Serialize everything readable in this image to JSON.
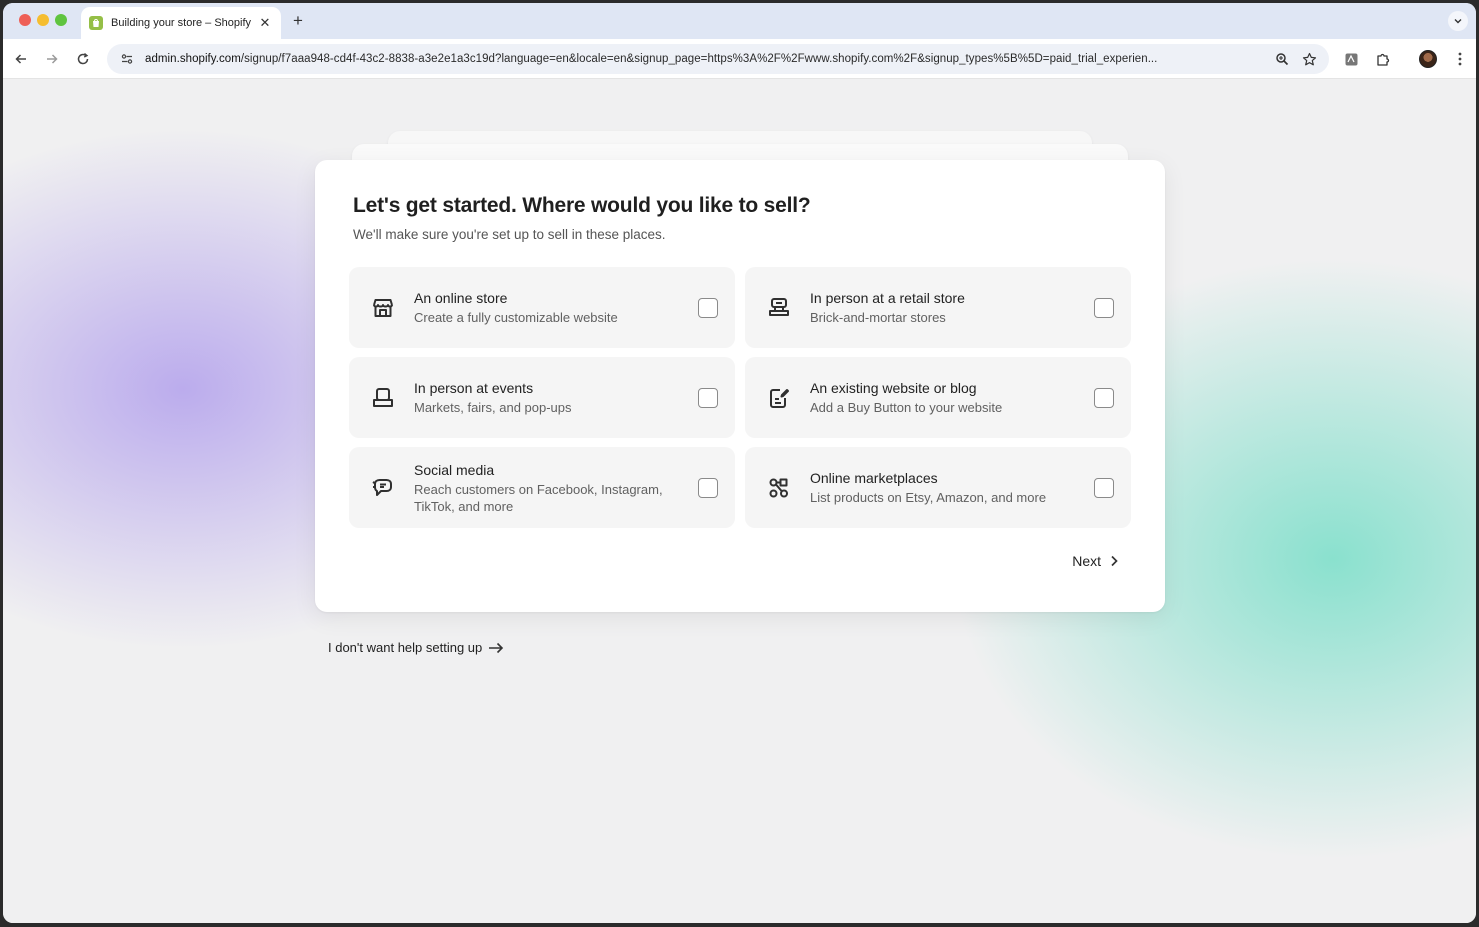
{
  "browser": {
    "tab": {
      "title": "Building your store – Shopify",
      "close": "✕"
    },
    "new_tab": "+",
    "url_host": "admin.shopify.com",
    "url_path": "/signup/f7aaa948-cd4f-43c2-8838-a3e2e1a3c19d?language=en&locale=en&signup_page=https%3A%2F%2Fwww.shopify.com%2F&signup_types%5B%5D=paid_trial_experien..."
  },
  "page": {
    "title": "Let's get started. Where would you like to sell?",
    "subtitle": "We'll make sure you're set up to sell in these places.",
    "options": [
      {
        "title": "An online store",
        "description": "Create a fully customizable website",
        "icon": "storefront-icon",
        "checked": false
      },
      {
        "title": "In person at a retail store",
        "description": "Brick-and-mortar stores",
        "icon": "pos-register-icon",
        "checked": false
      },
      {
        "title": "In person at events",
        "description": "Markets, fairs, and pop-ups",
        "icon": "market-stall-icon",
        "checked": false
      },
      {
        "title": "An existing website or blog",
        "description": "Add a Buy Button to your website",
        "icon": "edit-document-icon",
        "checked": false
      },
      {
        "title": "Social media",
        "description": "Reach customers on Facebook, Instagram, TikTok, and more",
        "icon": "chat-bubble-icon",
        "checked": false
      },
      {
        "title": "Online marketplaces",
        "description": "List products on Etsy, Amazon, and more",
        "icon": "marketplace-network-icon",
        "checked": false
      }
    ],
    "next_label": "Next",
    "skip_label": "I don't want help setting up"
  },
  "colors": {
    "tabstrip": "#dfe6f4",
    "card": "#ffffff",
    "option_bg": "#f5f5f5",
    "accent_purple": "#b2a0ec",
    "accent_teal": "#78dec8",
    "shopify_green": "#95bf47"
  }
}
